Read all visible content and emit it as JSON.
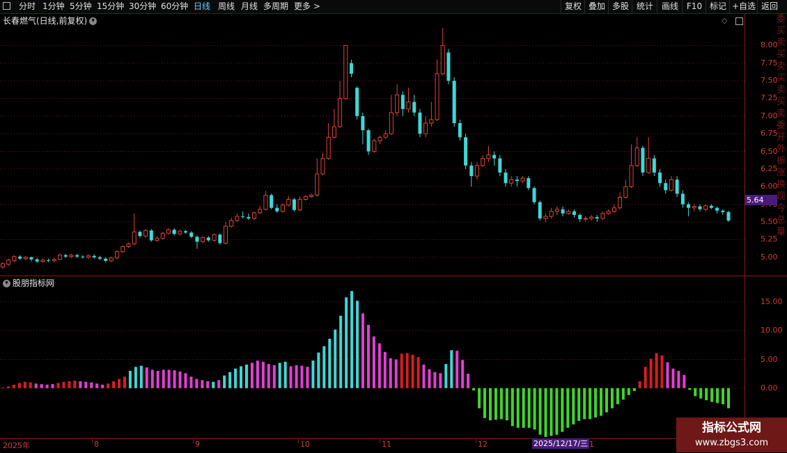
{
  "toolbar": {
    "periods": [
      "分时",
      "1分钟",
      "5分钟",
      "15分钟",
      "30分钟",
      "60分钟",
      "日线",
      "周线",
      "月线",
      "多周期",
      "更多 >"
    ],
    "active_period": "日线",
    "right_buttons": [
      "复权",
      "叠加",
      "多股",
      "统计",
      "画线",
      "F10",
      "标记",
      "+自选",
      "返回"
    ]
  },
  "chart_title": "长春燃气(日线,前复权)",
  "sub_title": "股朋指标网",
  "current_price": "5.64",
  "cursor_date": "2025/12/17/三",
  "date_labels": [
    "2025年",
    "8",
    "9",
    "10",
    "11",
    "12",
    "1"
  ],
  "right_strip_chars": "委买卖买卖买卖买卖委开外振涨换现今总量",
  "watermark": {
    "line1": "指标公式网",
    "line2": "www.zbgs3.com"
  },
  "colors": {
    "up": "#e0443a",
    "down": "#3fd7d7",
    "grid": "#7a1a1a",
    "axis_text": "#d23c3c",
    "osc_red": "#d81e1e",
    "osc_cyan": "#3fd7d7",
    "osc_magenta": "#e23fd4",
    "osc_green": "#3ed828"
  },
  "chart_data": [
    {
      "type": "candlestick",
      "title": "长春燃气(日线,前复权)",
      "yticks": [
        5.0,
        5.25,
        5.5,
        5.75,
        6.0,
        6.25,
        6.5,
        6.75,
        7.0,
        7.25,
        7.5,
        7.75,
        8.0
      ],
      "ylim": [
        4.8,
        8.25
      ],
      "candles": [
        [
          4.86,
          4.91,
          4.84,
          4.93
        ],
        [
          4.9,
          4.96,
          4.88,
          4.98
        ],
        [
          4.95,
          5.01,
          4.93,
          5.03
        ],
        [
          5.01,
          4.98,
          4.96,
          5.03
        ],
        [
          4.98,
          5.0,
          4.96,
          5.02
        ],
        [
          5.0,
          4.97,
          4.94,
          5.01
        ],
        [
          4.97,
          4.94,
          4.92,
          4.99
        ],
        [
          4.94,
          4.96,
          4.92,
          4.98
        ],
        [
          4.96,
          4.95,
          4.93,
          4.98
        ],
        [
          4.95,
          4.97,
          4.93,
          4.99
        ],
        [
          4.97,
          5.03,
          4.96,
          5.05
        ],
        [
          5.03,
          5.01,
          4.99,
          5.05
        ],
        [
          5.01,
          5.03,
          4.99,
          5.05
        ],
        [
          5.03,
          5.01,
          4.99,
          5.05
        ],
        [
          5.01,
          5.0,
          4.98,
          5.03
        ],
        [
          5.0,
          5.02,
          4.98,
          5.04
        ],
        [
          5.02,
          5.0,
          4.98,
          5.04
        ],
        [
          5.0,
          4.98,
          4.96,
          5.02
        ],
        [
          4.98,
          4.95,
          4.93,
          5.0
        ],
        [
          4.95,
          4.99,
          4.93,
          5.01
        ],
        [
          4.99,
          5.08,
          4.97,
          5.1
        ],
        [
          5.08,
          5.15,
          5.06,
          5.17
        ],
        [
          5.15,
          5.19,
          5.13,
          5.21
        ],
        [
          5.19,
          5.36,
          5.17,
          5.62
        ],
        [
          5.36,
          5.3,
          5.28,
          5.38
        ],
        [
          5.3,
          5.38,
          5.28,
          5.4
        ],
        [
          5.38,
          5.24,
          5.22,
          5.4
        ],
        [
          5.24,
          5.27,
          5.22,
          5.3
        ],
        [
          5.27,
          5.34,
          5.25,
          5.36
        ],
        [
          5.34,
          5.39,
          5.32,
          5.41
        ],
        [
          5.39,
          5.33,
          5.31,
          5.41
        ],
        [
          5.33,
          5.37,
          5.31,
          5.39
        ],
        [
          5.37,
          5.35,
          5.33,
          5.39
        ],
        [
          5.35,
          5.29,
          5.27,
          5.37
        ],
        [
          5.29,
          5.22,
          5.12,
          5.31
        ],
        [
          5.22,
          5.28,
          5.2,
          5.3
        ],
        [
          5.28,
          5.24,
          5.22,
          5.3
        ],
        [
          5.24,
          5.32,
          5.22,
          5.34
        ],
        [
          5.32,
          5.2,
          5.18,
          5.34
        ],
        [
          5.2,
          5.44,
          5.18,
          5.5
        ],
        [
          5.44,
          5.52,
          5.42,
          5.56
        ],
        [
          5.52,
          5.58,
          5.5,
          5.62
        ],
        [
          5.58,
          5.57,
          5.55,
          5.65
        ],
        [
          5.57,
          5.55,
          5.53,
          5.62
        ],
        [
          5.55,
          5.63,
          5.53,
          5.65
        ],
        [
          5.63,
          5.68,
          5.61,
          5.73
        ],
        [
          5.68,
          5.88,
          5.66,
          5.94
        ],
        [
          5.88,
          5.7,
          5.68,
          5.9
        ],
        [
          5.7,
          5.65,
          5.63,
          5.75
        ],
        [
          5.65,
          5.74,
          5.63,
          5.76
        ],
        [
          5.74,
          5.82,
          5.72,
          5.87
        ],
        [
          5.82,
          5.67,
          5.65,
          5.84
        ],
        [
          5.67,
          5.82,
          5.65,
          5.86
        ],
        [
          5.82,
          5.86,
          5.8,
          5.88
        ],
        [
          5.86,
          5.88,
          5.84,
          5.9
        ],
        [
          5.88,
          6.18,
          5.86,
          6.4
        ],
        [
          6.18,
          6.4,
          6.16,
          6.48
        ],
        [
          6.4,
          6.7,
          6.38,
          6.9
        ],
        [
          6.7,
          6.85,
          6.68,
          7.1
        ],
        [
          6.85,
          7.25,
          6.83,
          7.5
        ],
        [
          7.25,
          8.0,
          7.23,
          8.0
        ],
        [
          7.75,
          7.6,
          7.55,
          7.8
        ],
        [
          7.4,
          7.0,
          6.95,
          7.42
        ],
        [
          7.0,
          6.8,
          6.6,
          7.05
        ],
        [
          6.8,
          6.5,
          6.45,
          6.82
        ],
        [
          6.5,
          6.65,
          6.48,
          6.68
        ],
        [
          6.65,
          6.7,
          6.6,
          6.72
        ],
        [
          6.7,
          6.75,
          6.68,
          6.8
        ],
        [
          6.75,
          7.05,
          6.73,
          7.3
        ],
        [
          7.05,
          7.3,
          7.0,
          7.45
        ],
        [
          7.3,
          7.1,
          7.0,
          7.35
        ],
        [
          7.1,
          7.2,
          7.05,
          7.4
        ],
        [
          7.2,
          7.05,
          7.0,
          7.3
        ],
        [
          7.05,
          6.75,
          6.7,
          7.1
        ],
        [
          6.75,
          6.9,
          6.7,
          7.0
        ],
        [
          6.9,
          6.95,
          6.85,
          7.2
        ],
        [
          6.95,
          7.6,
          6.93,
          7.8
        ],
        [
          7.6,
          8.0,
          7.58,
          8.25
        ],
        [
          7.9,
          7.5,
          7.45,
          7.95
        ],
        [
          7.5,
          6.9,
          6.85,
          7.55
        ],
        [
          6.9,
          6.7,
          6.65,
          6.95
        ],
        [
          6.7,
          6.3,
          6.25,
          6.75
        ],
        [
          6.3,
          6.15,
          6.0,
          6.35
        ],
        [
          6.15,
          6.3,
          6.1,
          6.35
        ],
        [
          6.3,
          6.4,
          6.28,
          6.45
        ],
        [
          6.4,
          6.45,
          6.35,
          6.58
        ],
        [
          6.45,
          6.4,
          6.3,
          6.5
        ],
        [
          6.4,
          6.2,
          6.15,
          6.45
        ],
        [
          6.2,
          6.05,
          6.0,
          6.25
        ],
        [
          6.05,
          6.1,
          6.0,
          6.15
        ],
        [
          6.1,
          6.08,
          6.0,
          6.15
        ],
        [
          6.08,
          6.12,
          6.05,
          6.15
        ],
        [
          6.12,
          5.98,
          5.95,
          6.15
        ],
        [
          5.98,
          5.78,
          5.75,
          6.0
        ],
        [
          5.78,
          5.55,
          5.52,
          5.8
        ],
        [
          5.55,
          5.58,
          5.5,
          5.62
        ],
        [
          5.58,
          5.65,
          5.55,
          5.7
        ],
        [
          5.65,
          5.68,
          5.6,
          5.72
        ],
        [
          5.68,
          5.62,
          5.58,
          5.72
        ],
        [
          5.62,
          5.65,
          5.6,
          5.68
        ],
        [
          5.65,
          5.6,
          5.56,
          5.68
        ],
        [
          5.6,
          5.54,
          5.5,
          5.62
        ],
        [
          5.54,
          5.55,
          5.5,
          5.58
        ],
        [
          5.55,
          5.57,
          5.52,
          5.6
        ],
        [
          5.57,
          5.55,
          5.5,
          5.6
        ],
        [
          5.55,
          5.62,
          5.53,
          5.65
        ],
        [
          5.62,
          5.65,
          5.6,
          5.68
        ],
        [
          5.65,
          5.7,
          5.63,
          5.75
        ],
        [
          5.7,
          5.85,
          5.68,
          5.92
        ],
        [
          5.85,
          6.0,
          5.83,
          6.1
        ],
        [
          6.0,
          6.3,
          5.98,
          6.6
        ],
        [
          6.3,
          6.55,
          6.28,
          6.7
        ],
        [
          6.55,
          6.2,
          6.15,
          6.58
        ],
        [
          6.2,
          6.4,
          6.18,
          6.7
        ],
        [
          6.4,
          6.2,
          6.15,
          6.45
        ],
        [
          6.2,
          6.05,
          6.0,
          6.25
        ],
        [
          6.05,
          5.95,
          5.9,
          6.1
        ],
        [
          5.95,
          6.1,
          5.93,
          6.15
        ],
        [
          6.1,
          5.9,
          5.85,
          6.15
        ],
        [
          5.9,
          5.75,
          5.7,
          5.95
        ],
        [
          5.75,
          5.7,
          5.58,
          5.78
        ],
        [
          5.7,
          5.72,
          5.65,
          5.76
        ],
        [
          5.72,
          5.68,
          5.65,
          5.75
        ],
        [
          5.68,
          5.73,
          5.65,
          5.75
        ],
        [
          5.73,
          5.7,
          5.68,
          5.75
        ],
        [
          5.7,
          5.66,
          5.62,
          5.72
        ],
        [
          5.66,
          5.64,
          5.6,
          5.68
        ],
        [
          5.64,
          5.52,
          5.5,
          5.66
        ]
      ]
    },
    {
      "type": "bar",
      "title": "股朋指标网",
      "yticks": [
        0.0,
        5.0,
        10.0,
        15.0
      ],
      "ylim": [
        -8.5,
        18.5
      ],
      "values": [
        0.1,
        0.3,
        0.6,
        0.9,
        1.1,
        1.0,
        0.8,
        0.7,
        0.6,
        0.7,
        0.9,
        1.1,
        1.2,
        1.3,
        1.2,
        1.1,
        1.0,
        0.8,
        0.6,
        0.8,
        1.2,
        1.6,
        2.0,
        3.0,
        3.7,
        3.9,
        3.6,
        3.2,
        3.0,
        3.2,
        3.2,
        3.1,
        2.9,
        2.6,
        2.0,
        1.6,
        1.4,
        1.2,
        1.1,
        1.4,
        2.2,
        2.8,
        3.4,
        3.8,
        4.1,
        4.4,
        4.8,
        4.6,
        4.2,
        4.0,
        4.4,
        4.6,
        3.8,
        4.0,
        3.9,
        3.7,
        4.8,
        6.2,
        7.3,
        8.6,
        10.2,
        12.6,
        15.8,
        16.9,
        15.2,
        13.0,
        11.0,
        9.0,
        7.8,
        6.3,
        5.2,
        5.0,
        6.0,
        6.1,
        5.8,
        5.4,
        4.1,
        3.3,
        2.8,
        2.6,
        4.2,
        6.6,
        6.5,
        4.9,
        2.5,
        -0.4,
        -3.5,
        -5.2,
        -5.6,
        -5.5,
        -5.4,
        -5.6,
        -6.6,
        -6.9,
        -6.9,
        -6.9,
        -7.2,
        -8.1,
        -8.5,
        -8.3,
        -8.1,
        -7.6,
        -6.9,
        -6.3,
        -5.7,
        -5.4,
        -5.4,
        -5.1,
        -4.8,
        -4.2,
        -3.5,
        -2.8,
        -2.0,
        -1.2,
        -0.5,
        1.2,
        3.7,
        5.1,
        6.1,
        5.7,
        4.5,
        3.4,
        3.0,
        2.3,
        -0.3,
        -1.4,
        -1.8,
        -2.1,
        -2.4,
        -2.6,
        -2.8,
        -3.5
      ],
      "bar_colors": [
        "red",
        "red",
        "red",
        "red",
        "red",
        "red",
        "magenta",
        "magenta",
        "magenta",
        "magenta",
        "red",
        "red",
        "red",
        "red",
        "magenta",
        "magenta",
        "magenta",
        "magenta",
        "magenta",
        "red",
        "red",
        "red",
        "red",
        "cyan",
        "cyan",
        "cyan",
        "magenta",
        "magenta",
        "magenta",
        "magenta",
        "magenta",
        "magenta",
        "magenta",
        "magenta",
        "magenta",
        "magenta",
        "magenta",
        "magenta",
        "cyan",
        "magenta",
        "cyan",
        "cyan",
        "cyan",
        "cyan",
        "cyan",
        "magenta",
        "magenta",
        "magenta",
        "magenta",
        "magenta",
        "cyan",
        "cyan",
        "magenta",
        "magenta",
        "magenta",
        "magenta",
        "cyan",
        "cyan",
        "cyan",
        "cyan",
        "cyan",
        "cyan",
        "cyan",
        "cyan",
        "cyan",
        "magenta",
        "magenta",
        "magenta",
        "magenta",
        "magenta",
        "magenta",
        "magenta",
        "red",
        "red",
        "red",
        "red",
        "magenta",
        "magenta",
        "magenta",
        "magenta",
        "cyan",
        "cyan",
        "magenta",
        "magenta",
        "magenta",
        "green",
        "green",
        "green",
        "green",
        "green",
        "green",
        "green",
        "green",
        "green",
        "green",
        "green",
        "green",
        "green",
        "green",
        "green",
        "green",
        "green",
        "green",
        "green",
        "green",
        "green",
        "green",
        "green",
        "green",
        "green",
        "green",
        "green",
        "green",
        "green",
        "green",
        "red",
        "red",
        "red",
        "red",
        "red",
        "magenta",
        "magenta",
        "magenta",
        "magenta",
        "green",
        "green",
        "green",
        "green",
        "green",
        "green",
        "green",
        "green"
      ]
    }
  ]
}
